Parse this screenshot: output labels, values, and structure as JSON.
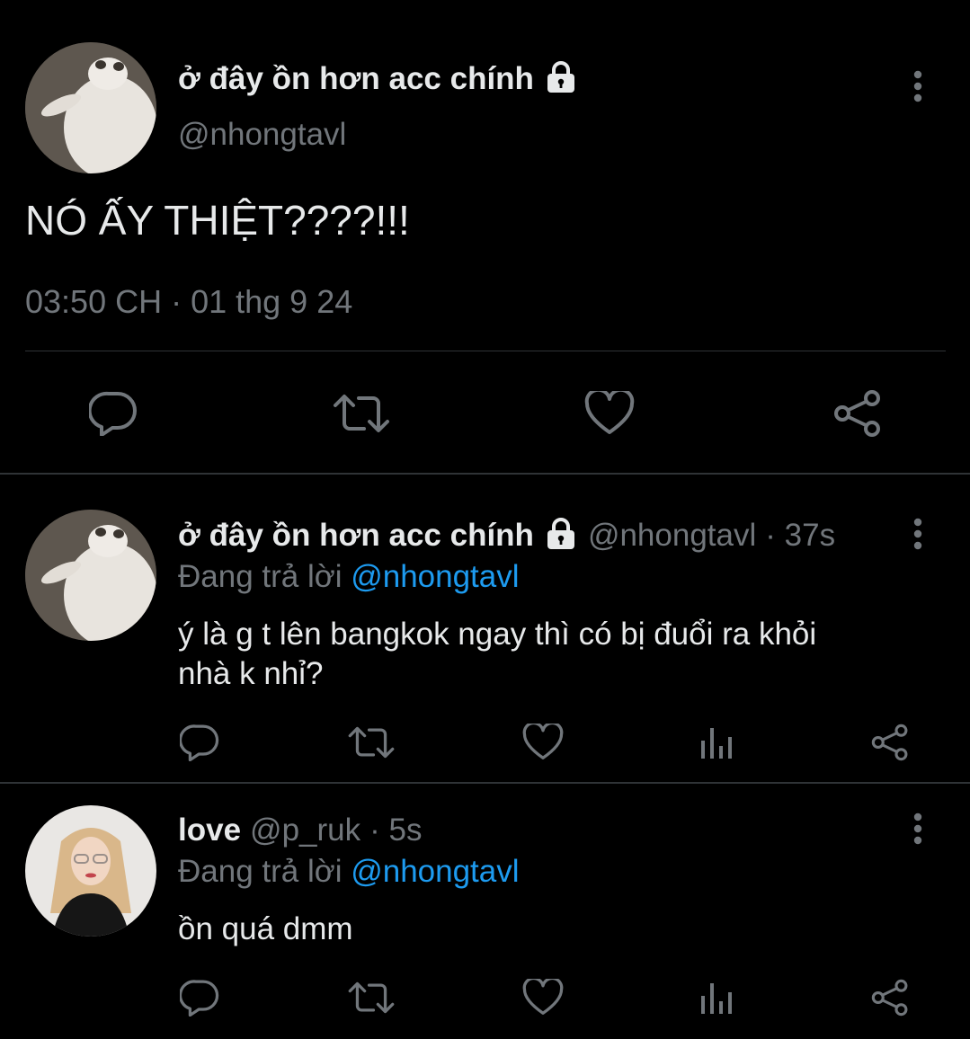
{
  "main_tweet": {
    "display_name": "ở đây ồn hơn acc chính",
    "handle": "@nhongtavl",
    "text": "NÓ ẤY THIỆT????!!!",
    "timestamp": "03:50 CH · 01 thg 9 24",
    "icons": [
      "lock-icon",
      "more-icon",
      "reply-icon",
      "retweet-icon",
      "like-icon",
      "share-icon"
    ]
  },
  "replies": [
    {
      "display_name": "ở đây ồn hơn acc chính",
      "handle": "@nhongtavl",
      "time": "· 37s",
      "replying_prefix": "Đang trả lời",
      "replying_to": "@nhongtavl",
      "text_line1": "ý là g t lên bangkok ngay thì có bị đuổi ra khỏi",
      "text_line2": "nhà k nhỉ?"
    },
    {
      "display_name": "love",
      "handle": "@p_ruk",
      "time": "· 5s",
      "replying_prefix": "Đang trả lời",
      "replying_to": "@nhongtavl",
      "text_line1": "ồn quá dmm"
    }
  ],
  "colors": {
    "background": "#000000",
    "text": "#e7e9ea",
    "muted": "#71767b",
    "link": "#1d9bf0",
    "divider": "#2f3336"
  }
}
